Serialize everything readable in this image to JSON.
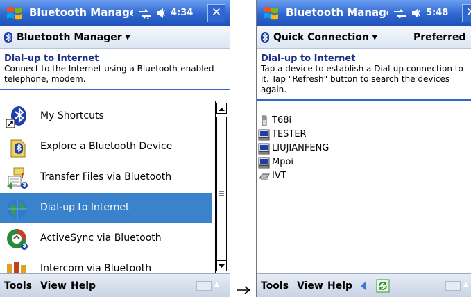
{
  "left": {
    "title": "Bluetooth Manager",
    "status_time": "4:34",
    "header_label": "Bluetooth Manager",
    "description": {
      "heading": "Dial-up to Internet",
      "text": "Connect to the Internet using a Bluetooth-enabled telephone, modem."
    },
    "items": [
      {
        "label": "My Shortcuts",
        "icon": "bluetooth-shortcut-icon"
      },
      {
        "label": "Explore a Bluetooth Device",
        "icon": "explore-device-icon"
      },
      {
        "label": "Transfer Files via Bluetooth",
        "icon": "transfer-files-icon"
      },
      {
        "label": "Dial-up to Internet",
        "icon": "globe-icon",
        "selected": true
      },
      {
        "label": "ActiveSync via Bluetooth",
        "icon": "activesync-icon"
      },
      {
        "label": "Intercom via Bluetooth",
        "icon": "intercom-icon"
      }
    ],
    "menu": {
      "tools": "Tools",
      "view": "View",
      "help": "Help"
    }
  },
  "right": {
    "title": "Bluetooth Manager",
    "status_time": "5:48",
    "header_label": "Quick Connection",
    "header_right": "Preferred",
    "description": {
      "heading": "Dial-up to Internet",
      "text": "Tap a device to establish a Dial-up connection to it. Tap \"Refresh\" button to search the devices again."
    },
    "devices": [
      {
        "label": "T68i",
        "icon": "phone-icon"
      },
      {
        "label": "TESTER",
        "icon": "computer-icon"
      },
      {
        "label": "LIUJIANFENG",
        "icon": "computer-icon"
      },
      {
        "label": "Mpoi",
        "icon": "computer-icon"
      },
      {
        "label": "IVT",
        "icon": "modem-icon"
      }
    ],
    "menu": {
      "tools": "Tools",
      "view": "View",
      "help": "Help"
    }
  },
  "colors": {
    "titlebar": "#2f66d0",
    "selection": "#3a82cc",
    "heading_text": "#1e2f8a"
  }
}
